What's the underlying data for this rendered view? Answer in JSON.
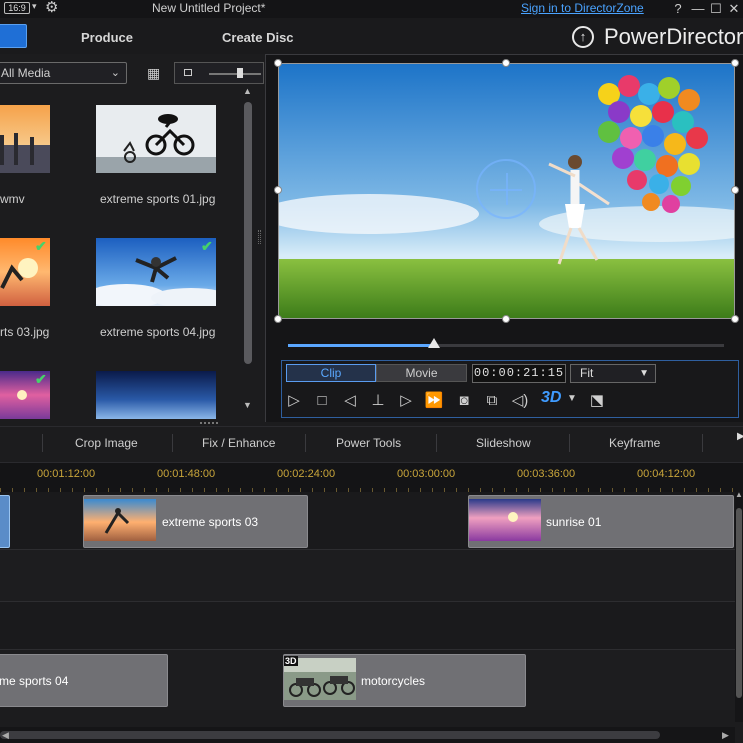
{
  "titlebar": {
    "aspect": "16:9",
    "title": "New Untitled Project*",
    "signin": "Sign in to DirectorZone",
    "help": "?",
    "minimize": "—",
    "maximize": "☐",
    "close": "✕"
  },
  "modules": {
    "produce": "Produce",
    "create_disc": "Create Disc",
    "brand": "PowerDirector"
  },
  "library": {
    "media_filter": "All Media",
    "items": [
      {
        "label": "wmv",
        "checked": false
      },
      {
        "label": "extreme sports 01.jpg",
        "checked": false
      },
      {
        "label": "rts 03.jpg",
        "checked": true
      },
      {
        "label": "extreme sports 04.jpg",
        "checked": true
      },
      {
        "label": "",
        "checked": true
      },
      {
        "label": "",
        "checked": false
      }
    ]
  },
  "preview": {
    "clip_tab": "Clip",
    "movie_tab": "Movie",
    "timecode": "00:00:21:15",
    "fit": "Fit",
    "seek_progress": 0.336,
    "btn_3d": "3D"
  },
  "toolbar": {
    "crop_image": "Crop Image",
    "fix_enhance": "Fix / Enhance",
    "power_tools": "Power Tools",
    "slideshow": "Slideshow",
    "keyframe": "Keyframe"
  },
  "timeline": {
    "ruler": [
      "00:01:12:00",
      "00:01:48:00",
      "00:02:24:00",
      "00:03:00:00",
      "00:03:36:00",
      "00:04:12:00"
    ],
    "clips": {
      "extreme_sports_03": "extreme sports 03",
      "sunrise_01": "sunrise 01",
      "extreme_sports_04": "me sports 04",
      "motorcycles": "motorcycles",
      "badge_3d": "3D"
    }
  },
  "colors": {
    "accent": "#1f6fd6",
    "timecode_gold": "#c9a53a",
    "check_green": "#46d26a"
  }
}
